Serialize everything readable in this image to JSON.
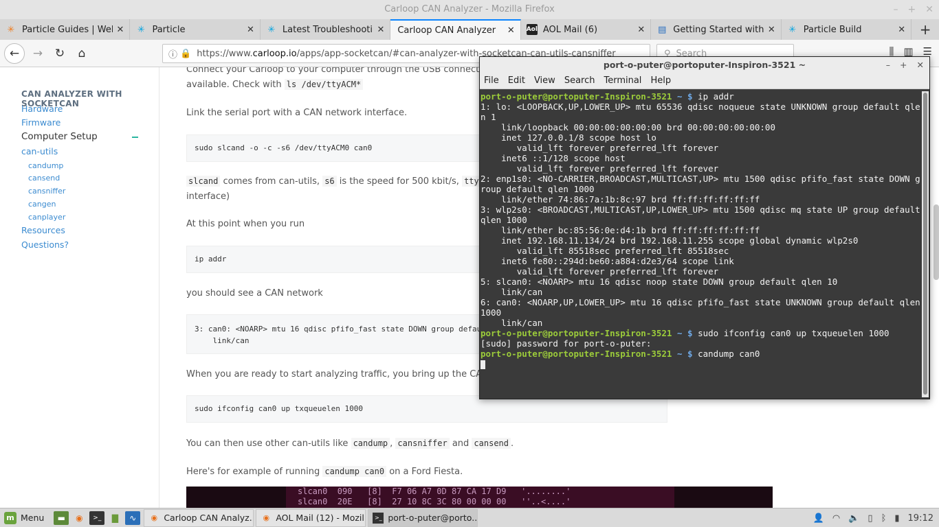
{
  "firefox": {
    "window_title": "Carloop CAN Analyzer - Mozilla Firefox",
    "tabs": [
      {
        "label": "Particle Guides | Web I",
        "icon": "particle-star-icon"
      },
      {
        "label": "Particle",
        "icon": "particle-star-icon"
      },
      {
        "label": "Latest Troubleshooting",
        "icon": "particle-star-icon"
      },
      {
        "label": "Carloop CAN Analyzer",
        "icon": ""
      },
      {
        "label": "AOL Mail (6)",
        "icon": "aol-icon"
      },
      {
        "label": "Getting Started with Ca",
        "icon": "book-icon"
      },
      {
        "label": "Particle Build",
        "icon": "particle-star-icon"
      }
    ],
    "url": "https://www.carloop.io/apps/app-socketcan/#can-analyzer-with-socketcan-can-utils-cansniffer",
    "url_domain": "carloop.io",
    "search_placeholder": "Search"
  },
  "sidebar": {
    "heading": "CAN ANALYZER WITH SOCKETCAN",
    "items": [
      "Hardware",
      "Firmware",
      "Computer Setup",
      "can-utils",
      "candump",
      "cansend",
      "cansniffer",
      "cangen",
      "canplayer",
      "Resources",
      "Questions?"
    ]
  },
  "article": {
    "p0_a": "Connect your Carloop to your computer through the USB connector. A se",
    "p0_b": "available. Check with",
    "p0_code": "ls /dev/ttyACM*",
    "p1": "Link the serial port with a CAN network interface.",
    "code1": "sudo slcand -o -c -s6 /dev/ttyACM0 can0",
    "p2_code1": "slcand",
    "p2_t1": "comes from can-utils,",
    "p2_code2": "s6",
    "p2_t2": "is the speed for 500 kbit/s,",
    "p2_code3": "ttyACM0",
    "p2_t3": "is",
    "p2_b": "interface)",
    "p3": "At this point when you run",
    "code2": "ip addr",
    "p4": "you should see a CAN network",
    "code3": "3: can0: <NOARP> mtu 16 qdisc pfifo_fast state DOWN group default qle\n    link/can",
    "p5": "When you are ready to start analyzing traffic, you bring up the CAN network interface",
    "code4": "sudo ifconfig can0 up txqueuelen 1000",
    "p6_t1": "You can then use other can-utils like",
    "p6_c1": "candump",
    "p6_c2": "cansniffer",
    "p6_and": "and",
    "p6_c3": "cansend",
    "p7_t1": "Here's for example of running",
    "p7_c1": "candump can0",
    "p7_t2": "on a Ford Fiesta.",
    "sniff_lines": "slcan0  090   [8]  F7 06 A7 0D 87 CA 17 D9   '........'\nslcan0  20E   [8]  27 10 8C 3C 80 00 00 00   ''..<....'"
  },
  "terminal": {
    "title": "port-o-puter@portoputer-Inspiron-3521 ~",
    "menu": [
      "File",
      "Edit",
      "View",
      "Search",
      "Terminal",
      "Help"
    ],
    "prompt": "port-o-puter@portoputer-Inspiron-3521",
    "prompt_sym": "~ $",
    "cmd1": "ip addr",
    "output1": "1: lo: <LOOPBACK,UP,LOWER_UP> mtu 65536 qdisc noqueue state UNKNOWN group default qlen 1\n    link/loopback 00:00:00:00:00:00 brd 00:00:00:00:00:00\n    inet 127.0.0.1/8 scope host lo\n       valid_lft forever preferred_lft forever\n    inet6 ::1/128 scope host\n       valid_lft forever preferred_lft forever\n2: enp1s0: <NO-CARRIER,BROADCAST,MULTICAST,UP> mtu 1500 qdisc pfifo_fast state DOWN group default qlen 1000\n    link/ether 74:86:7a:1b:8c:97 brd ff:ff:ff:ff:ff:ff\n3: wlp2s0: <BROADCAST,MULTICAST,UP,LOWER_UP> mtu 1500 qdisc mq state UP group default qlen 1000\n    link/ether bc:85:56:0e:d4:1b brd ff:ff:ff:ff:ff:ff\n    inet 192.168.11.134/24 brd 192.168.11.255 scope global dynamic wlp2s0\n       valid_lft 85518sec preferred_lft 85518sec\n    inet6 fe80::294d:be60:a884:d2e3/64 scope link\n       valid_lft forever preferred_lft forever\n5: slcan0: <NOARP> mtu 16 qdisc noop state DOWN group default qlen 10\n    link/can\n6: can0: <NOARP,UP,LOWER_UP> mtu 16 qdisc pfifo_fast state UNKNOWN group default qlen 1000\n    link/can",
    "cmd2": "sudo ifconfig can0 up txqueuelen 1000",
    "output2": "[sudo] password for port-o-puter:",
    "cmd3": "candump can0"
  },
  "taskbar": {
    "menu_label": "Menu",
    "tasks": [
      "Carloop CAN Analyz...",
      "AOL Mail (12) - Mozil...",
      "port-o-puter@porto..."
    ],
    "clock": "19:12"
  }
}
